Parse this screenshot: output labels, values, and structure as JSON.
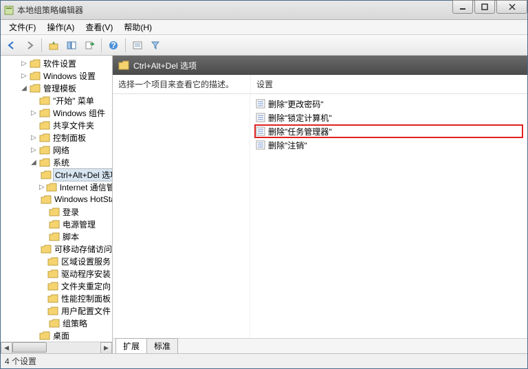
{
  "window": {
    "title": "本地组策略编辑器"
  },
  "menubar": {
    "file": "文件(F)",
    "action": "操作(A)",
    "view": "查看(V)",
    "help": "帮助(H)"
  },
  "tree": {
    "items": [
      {
        "indent": 2,
        "twisty": "▷",
        "label": "软件设置"
      },
      {
        "indent": 2,
        "twisty": "▷",
        "label": "Windows 设置"
      },
      {
        "indent": 2,
        "twisty": "◢",
        "label": "管理模板"
      },
      {
        "indent": 3,
        "twisty": "",
        "label": "\"开始\" 菜单"
      },
      {
        "indent": 3,
        "twisty": "▷",
        "label": "Windows 组件"
      },
      {
        "indent": 3,
        "twisty": "",
        "label": "共享文件夹"
      },
      {
        "indent": 3,
        "twisty": "▷",
        "label": "控制面板"
      },
      {
        "indent": 3,
        "twisty": "▷",
        "label": "网络"
      },
      {
        "indent": 3,
        "twisty": "◢",
        "label": "系统"
      },
      {
        "indent": 4,
        "twisty": "",
        "label": "Ctrl+Alt+Del 选项",
        "selected": true
      },
      {
        "indent": 4,
        "twisty": "▷",
        "label": "Internet 通信管理"
      },
      {
        "indent": 4,
        "twisty": "",
        "label": "Windows HotStart"
      },
      {
        "indent": 4,
        "twisty": "",
        "label": "登录"
      },
      {
        "indent": 4,
        "twisty": "",
        "label": "电源管理"
      },
      {
        "indent": 4,
        "twisty": "",
        "label": "脚本"
      },
      {
        "indent": 4,
        "twisty": "",
        "label": "可移动存储访问"
      },
      {
        "indent": 4,
        "twisty": "",
        "label": "区域设置服务"
      },
      {
        "indent": 4,
        "twisty": "",
        "label": "驱动程序安装"
      },
      {
        "indent": 4,
        "twisty": "",
        "label": "文件夹重定向"
      },
      {
        "indent": 4,
        "twisty": "",
        "label": "性能控制面板"
      },
      {
        "indent": 4,
        "twisty": "",
        "label": "用户配置文件"
      },
      {
        "indent": 4,
        "twisty": "",
        "label": "组策略"
      },
      {
        "indent": 3,
        "twisty": "",
        "label": "桌面"
      }
    ]
  },
  "path_header": "Ctrl+Alt+Del 选项",
  "desc_prompt": "选择一个项目来查看它的描述。",
  "settings_header": "设置",
  "list": [
    {
      "label": "删除\"更改密码\"",
      "highlight": false
    },
    {
      "label": "删除\"锁定计算机\"",
      "highlight": false
    },
    {
      "label": "删除\"任务管理器\"",
      "highlight": true
    },
    {
      "label": "删除\"注销\"",
      "highlight": false
    }
  ],
  "tabs": {
    "extended": "扩展",
    "standard": "标准"
  },
  "statusbar": "4 个设置"
}
